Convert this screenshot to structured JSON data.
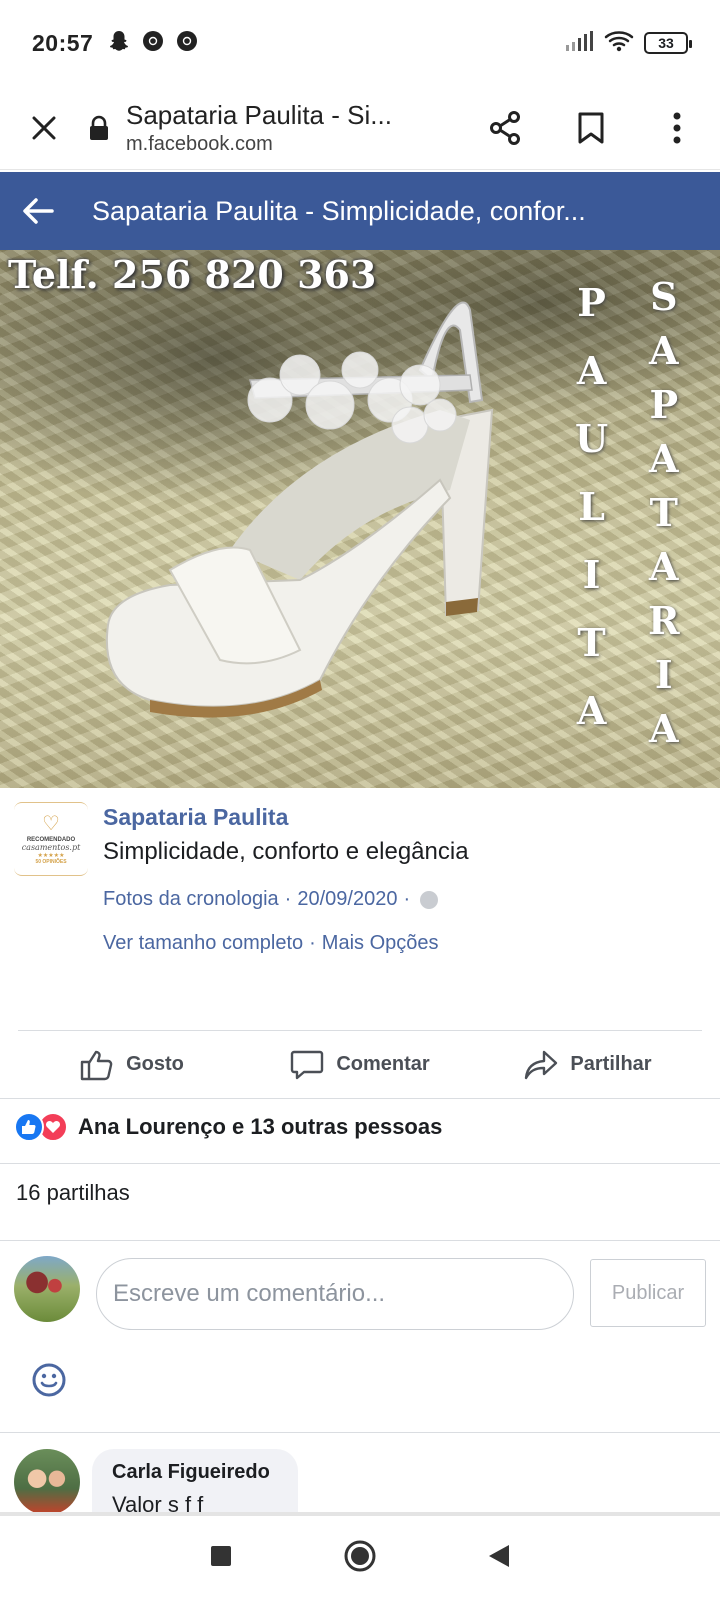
{
  "status_bar": {
    "time": "20:57",
    "battery": "33",
    "icons_left": [
      "snapchat-icon",
      "chrome-icon",
      "chrome-icon"
    ],
    "icons_right": [
      "signal-icon",
      "wifi-icon",
      "battery-icon"
    ]
  },
  "browser": {
    "title": "Sapataria Paulita - Si...",
    "domain": "m.facebook.com"
  },
  "fb_header": {
    "title": "Sapataria Paulita - Simplicidade, confor..."
  },
  "photo": {
    "phone": "Telf. 256 820 363",
    "vertical_left": [
      "P",
      "A",
      "U",
      "L",
      "I",
      "T",
      "A"
    ],
    "vertical_right": [
      "S",
      "A",
      "P",
      "A",
      "T",
      "A",
      "R",
      "I",
      "A"
    ]
  },
  "post": {
    "badge": {
      "line1": "RECOMENDADO",
      "line2": "casamentos.pt",
      "stars": "★★★★★",
      "line3": "50 OPINIÕES"
    },
    "page_name": "Sapataria Paulita",
    "caption": "Simplicidade, conforto e elegância",
    "album": "Fotos da cronologia",
    "separator": "·",
    "date": "20/09/2020",
    "link_full": "Ver tamanho completo",
    "link_more": "Mais Opções"
  },
  "actions": {
    "like": "Gosto",
    "comment": "Comentar",
    "share": "Partilhar"
  },
  "reactions": {
    "text": "Ana Lourenço e 13 outras pessoas"
  },
  "shares": "16 partilhas",
  "composer": {
    "placeholder": "Escreve um comentário...",
    "publish": "Publicar"
  },
  "comments": [
    {
      "author": "Carla Figueiredo",
      "text": "Valor s f f"
    }
  ],
  "colors": {
    "fb_blue": "#3b5998",
    "link_blue": "#4b67a1",
    "like_blue": "#1877f2",
    "love_red": "#f33e58"
  }
}
